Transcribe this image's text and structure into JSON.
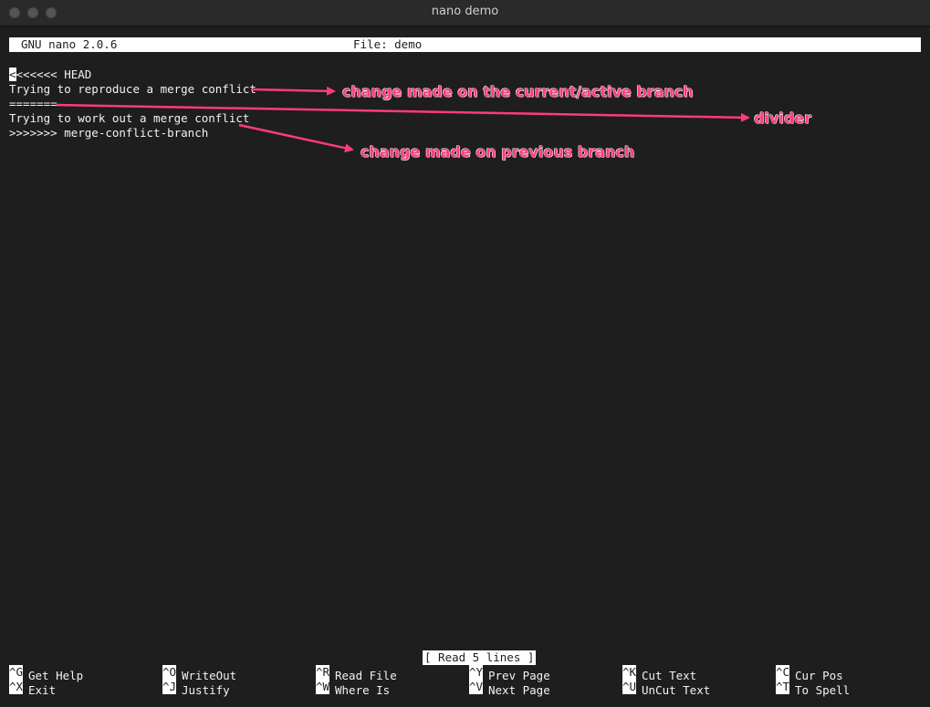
{
  "window": {
    "title": "nano demo"
  },
  "nano": {
    "version": "GNU nano 2.0.6",
    "file": "File: demo",
    "status": "[ Read 5 lines ]"
  },
  "content": {
    "lines": [
      "<<<<<<< HEAD",
      "Trying to reproduce a merge conflict",
      "=======",
      "Trying to work out a merge conflict",
      ">>>>>>> merge-conflict-branch"
    ]
  },
  "annotations": {
    "current_branch": "change made on the current/active branch",
    "divider": "divider",
    "previous_branch": "change made on previous branch",
    "color": "#ff3b7c"
  },
  "shortcuts": [
    {
      "key": "^G",
      "label": "Get Help"
    },
    {
      "key": "^O",
      "label": "WriteOut"
    },
    {
      "key": "^R",
      "label": "Read File"
    },
    {
      "key": "^Y",
      "label": "Prev Page"
    },
    {
      "key": "^K",
      "label": "Cut Text"
    },
    {
      "key": "^C",
      "label": "Cur Pos"
    },
    {
      "key": "^X",
      "label": "Exit"
    },
    {
      "key": "^J",
      "label": "Justify"
    },
    {
      "key": "^W",
      "label": "Where Is"
    },
    {
      "key": "^V",
      "label": "Next Page"
    },
    {
      "key": "^U",
      "label": "UnCut Text"
    },
    {
      "key": "^T",
      "label": "To Spell"
    }
  ]
}
